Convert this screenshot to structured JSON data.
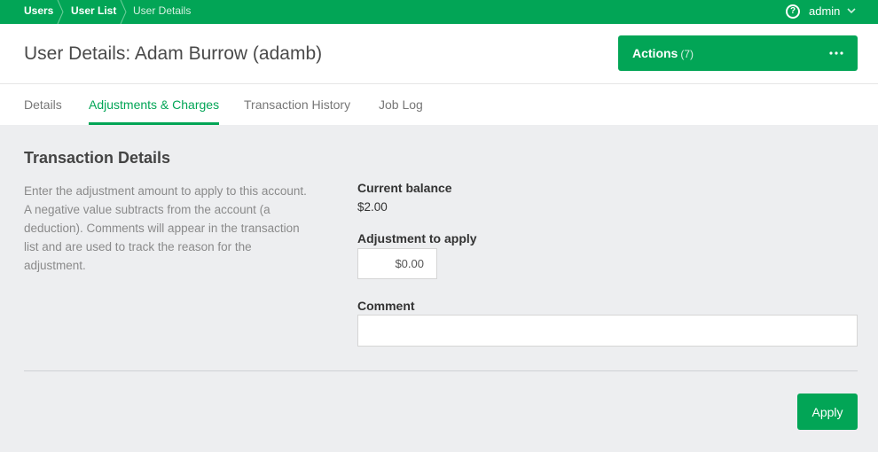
{
  "breadcrumb": {
    "items": [
      "Users",
      "User List",
      "User Details"
    ]
  },
  "user_menu": {
    "label": "admin",
    "help_icon": "question-circle-icon"
  },
  "header": {
    "title": "User Details: Adam Burrow (adamb)",
    "actions_label": "Actions",
    "actions_count": "(7)"
  },
  "tabs": [
    {
      "label": "Details",
      "active": false
    },
    {
      "label": "Adjustments & Charges",
      "active": true
    },
    {
      "label": "Transaction History",
      "active": false
    },
    {
      "label": "Job Log",
      "active": false
    }
  ],
  "section": {
    "title": "Transaction Details",
    "help": "Enter the adjustment amount to apply to this account. A negative value subtracts from the account (a deduction). Comments will appear in the transaction list and are used to track the reason for the adjustment."
  },
  "form": {
    "current_balance_label": "Current balance",
    "current_balance_value": "$2.00",
    "adjustment_label": "Adjustment to apply",
    "adjustment_value": "$0.00",
    "comment_label": "Comment",
    "comment_value": "",
    "apply_label": "Apply"
  },
  "colors": {
    "brand": "#02a556",
    "background": "#edeef0"
  }
}
